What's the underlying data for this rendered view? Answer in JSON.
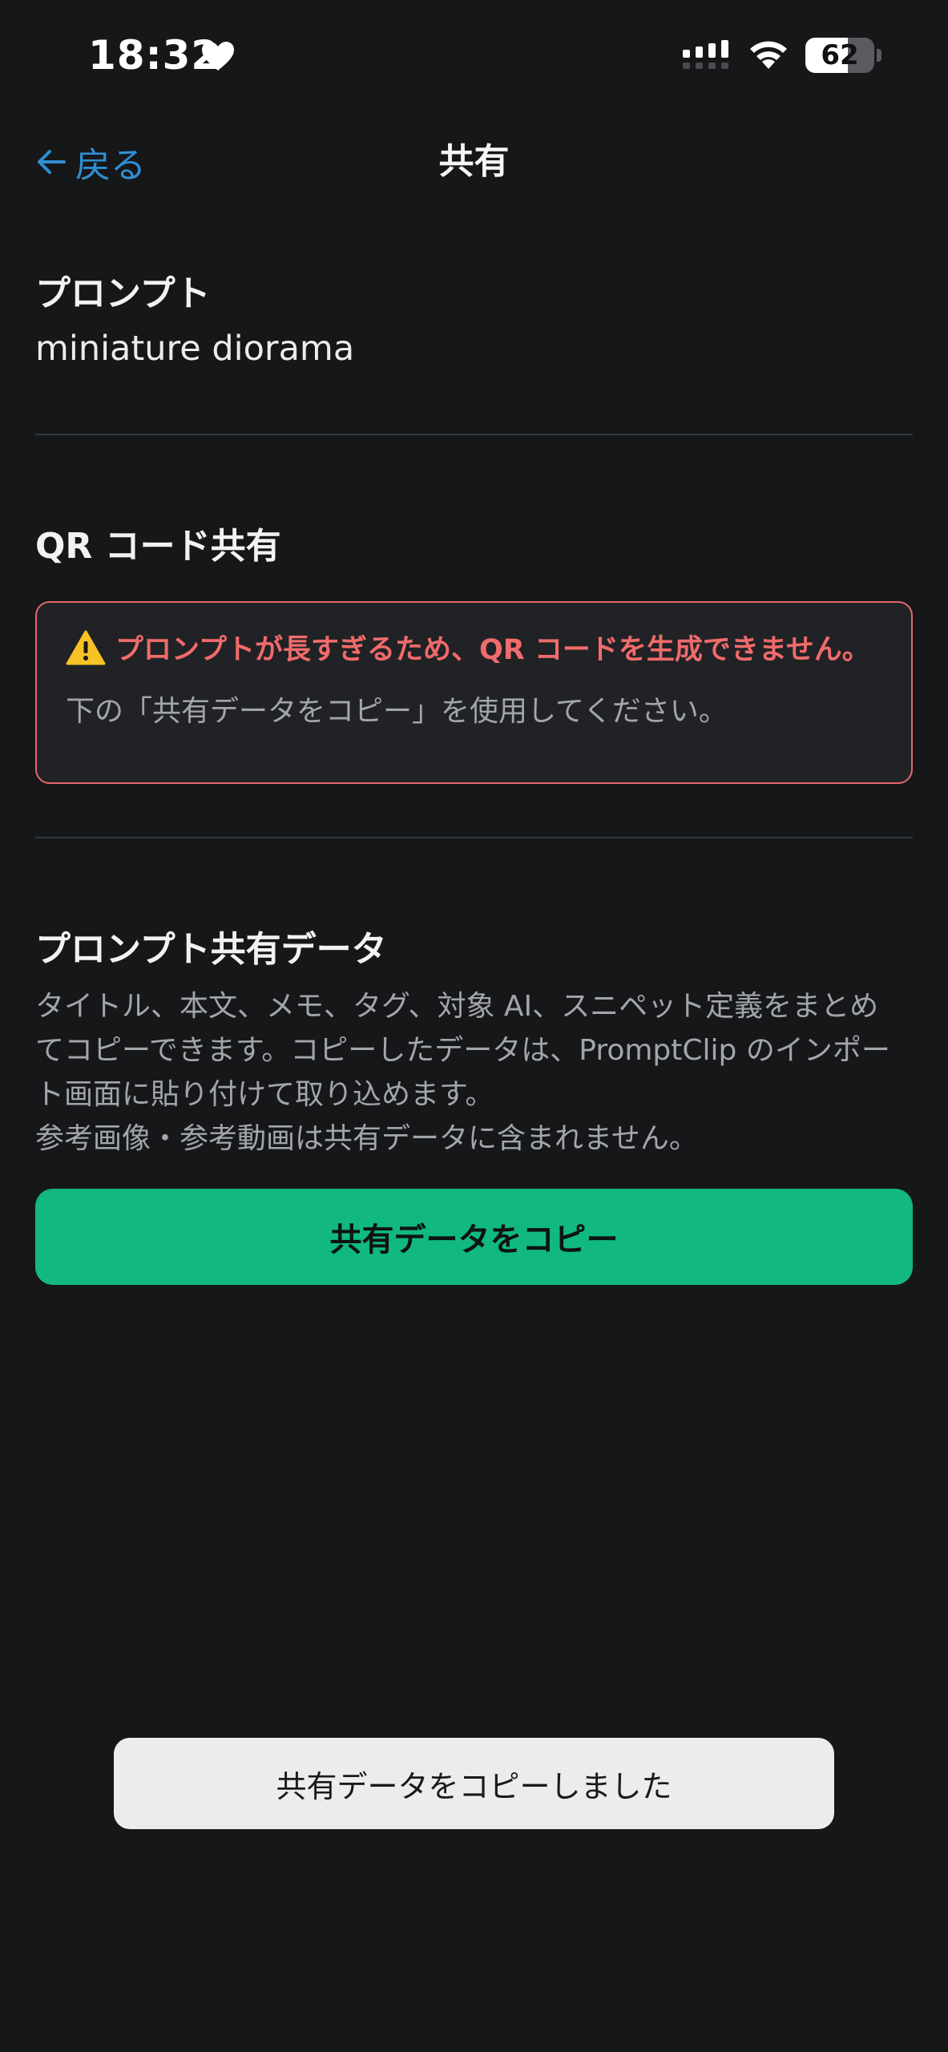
{
  "status_bar": {
    "time": "18:32",
    "battery": "62",
    "battery_level": 0.62
  },
  "nav": {
    "back_label": "戻る",
    "title": "共有"
  },
  "prompt_section": {
    "heading": "プロンプト",
    "value": "miniature diorama"
  },
  "qr_section": {
    "heading": "QR コード共有",
    "warning_title": "プロンプトが長すぎるため、QR コードを生成できません。",
    "warning_body": "下の「共有データをコピー」を使用してください。"
  },
  "share_data_section": {
    "heading": "プロンプト共有データ",
    "description_lines": [
      "タイトル、本文、メモ、タグ、対象 AI、スニペット定義をまとめ",
      "てコピーできます。コピーしたデータは、PromptClip のインポー",
      "ト画面に貼り付けて取り込めます。",
      "参考画像・参考動画は共有データに含まれません。"
    ],
    "copy_button_label": "共有データをコピー"
  },
  "toast": {
    "message": "共有データをコピーしました"
  },
  "colors": {
    "background": "#161719",
    "accent_link": "#2f8fd0",
    "warning": "#f06b6b",
    "primary_button": "#11b881",
    "toast_background": "#ececee"
  },
  "icons": [
    "heart-icon",
    "signal-icon",
    "wifi-icon",
    "battery-icon",
    "back-arrow-icon",
    "warning-icon"
  ]
}
